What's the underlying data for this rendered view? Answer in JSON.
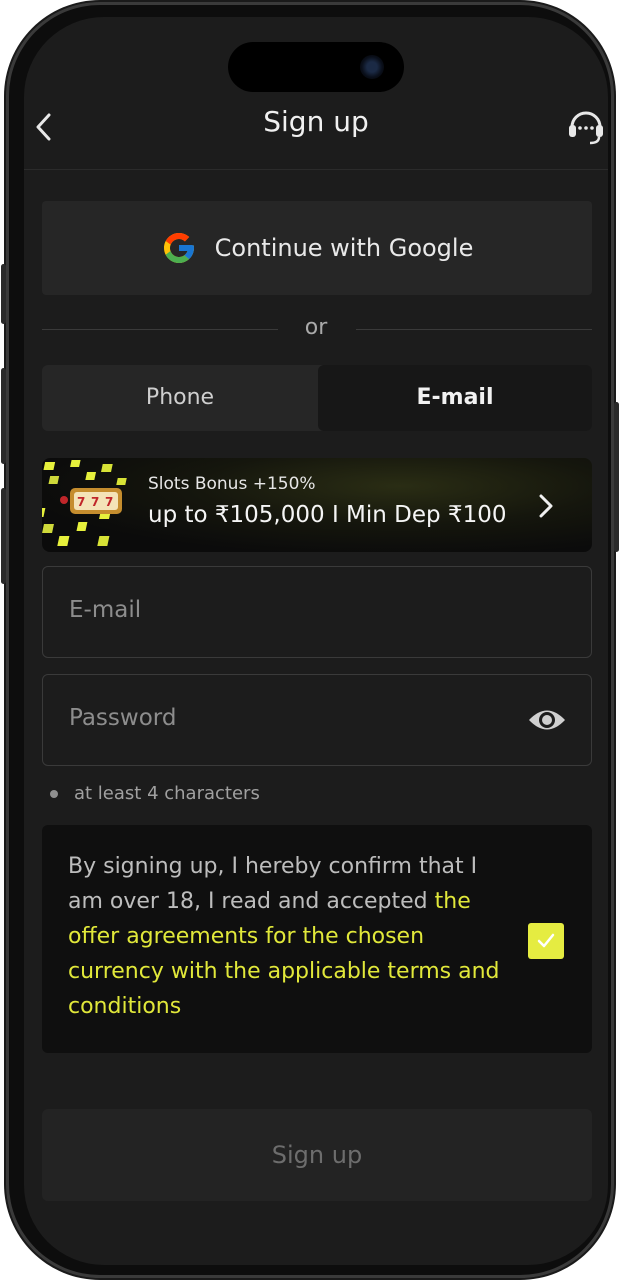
{
  "header": {
    "back_icon": "chevron-left-icon",
    "title": "Sign up",
    "support_icon": "headset-support-icon"
  },
  "google": {
    "label": "Continue with Google",
    "icon": "google-logo-icon"
  },
  "divider": {
    "label": "or"
  },
  "tabs": [
    {
      "label": "Phone",
      "selected": false
    },
    {
      "label": "E-mail",
      "selected": true
    }
  ],
  "promo": {
    "title": "Slots Bonus +150%",
    "subtitle": "up to ₹105,000 I Min Dep ₹100",
    "icon": "slot-machine-777-icon",
    "arrow_icon": "chevron-right-icon"
  },
  "form": {
    "email_placeholder": "E-mail",
    "password_placeholder": "Password",
    "eye_icon": "eye-icon",
    "hint": "at least 4 characters"
  },
  "consent": {
    "text_plain": "By signing up, I hereby confirm that I am over 18, I read and accepted ",
    "text_link": "the offer agreements for the chosen currency with the applicable terms and conditions",
    "checked": true,
    "check_color": "#e5ec41"
  },
  "submit": {
    "label": "Sign up"
  },
  "colors": {
    "accent": "#e1e83a",
    "background": "#1c1c1c"
  }
}
